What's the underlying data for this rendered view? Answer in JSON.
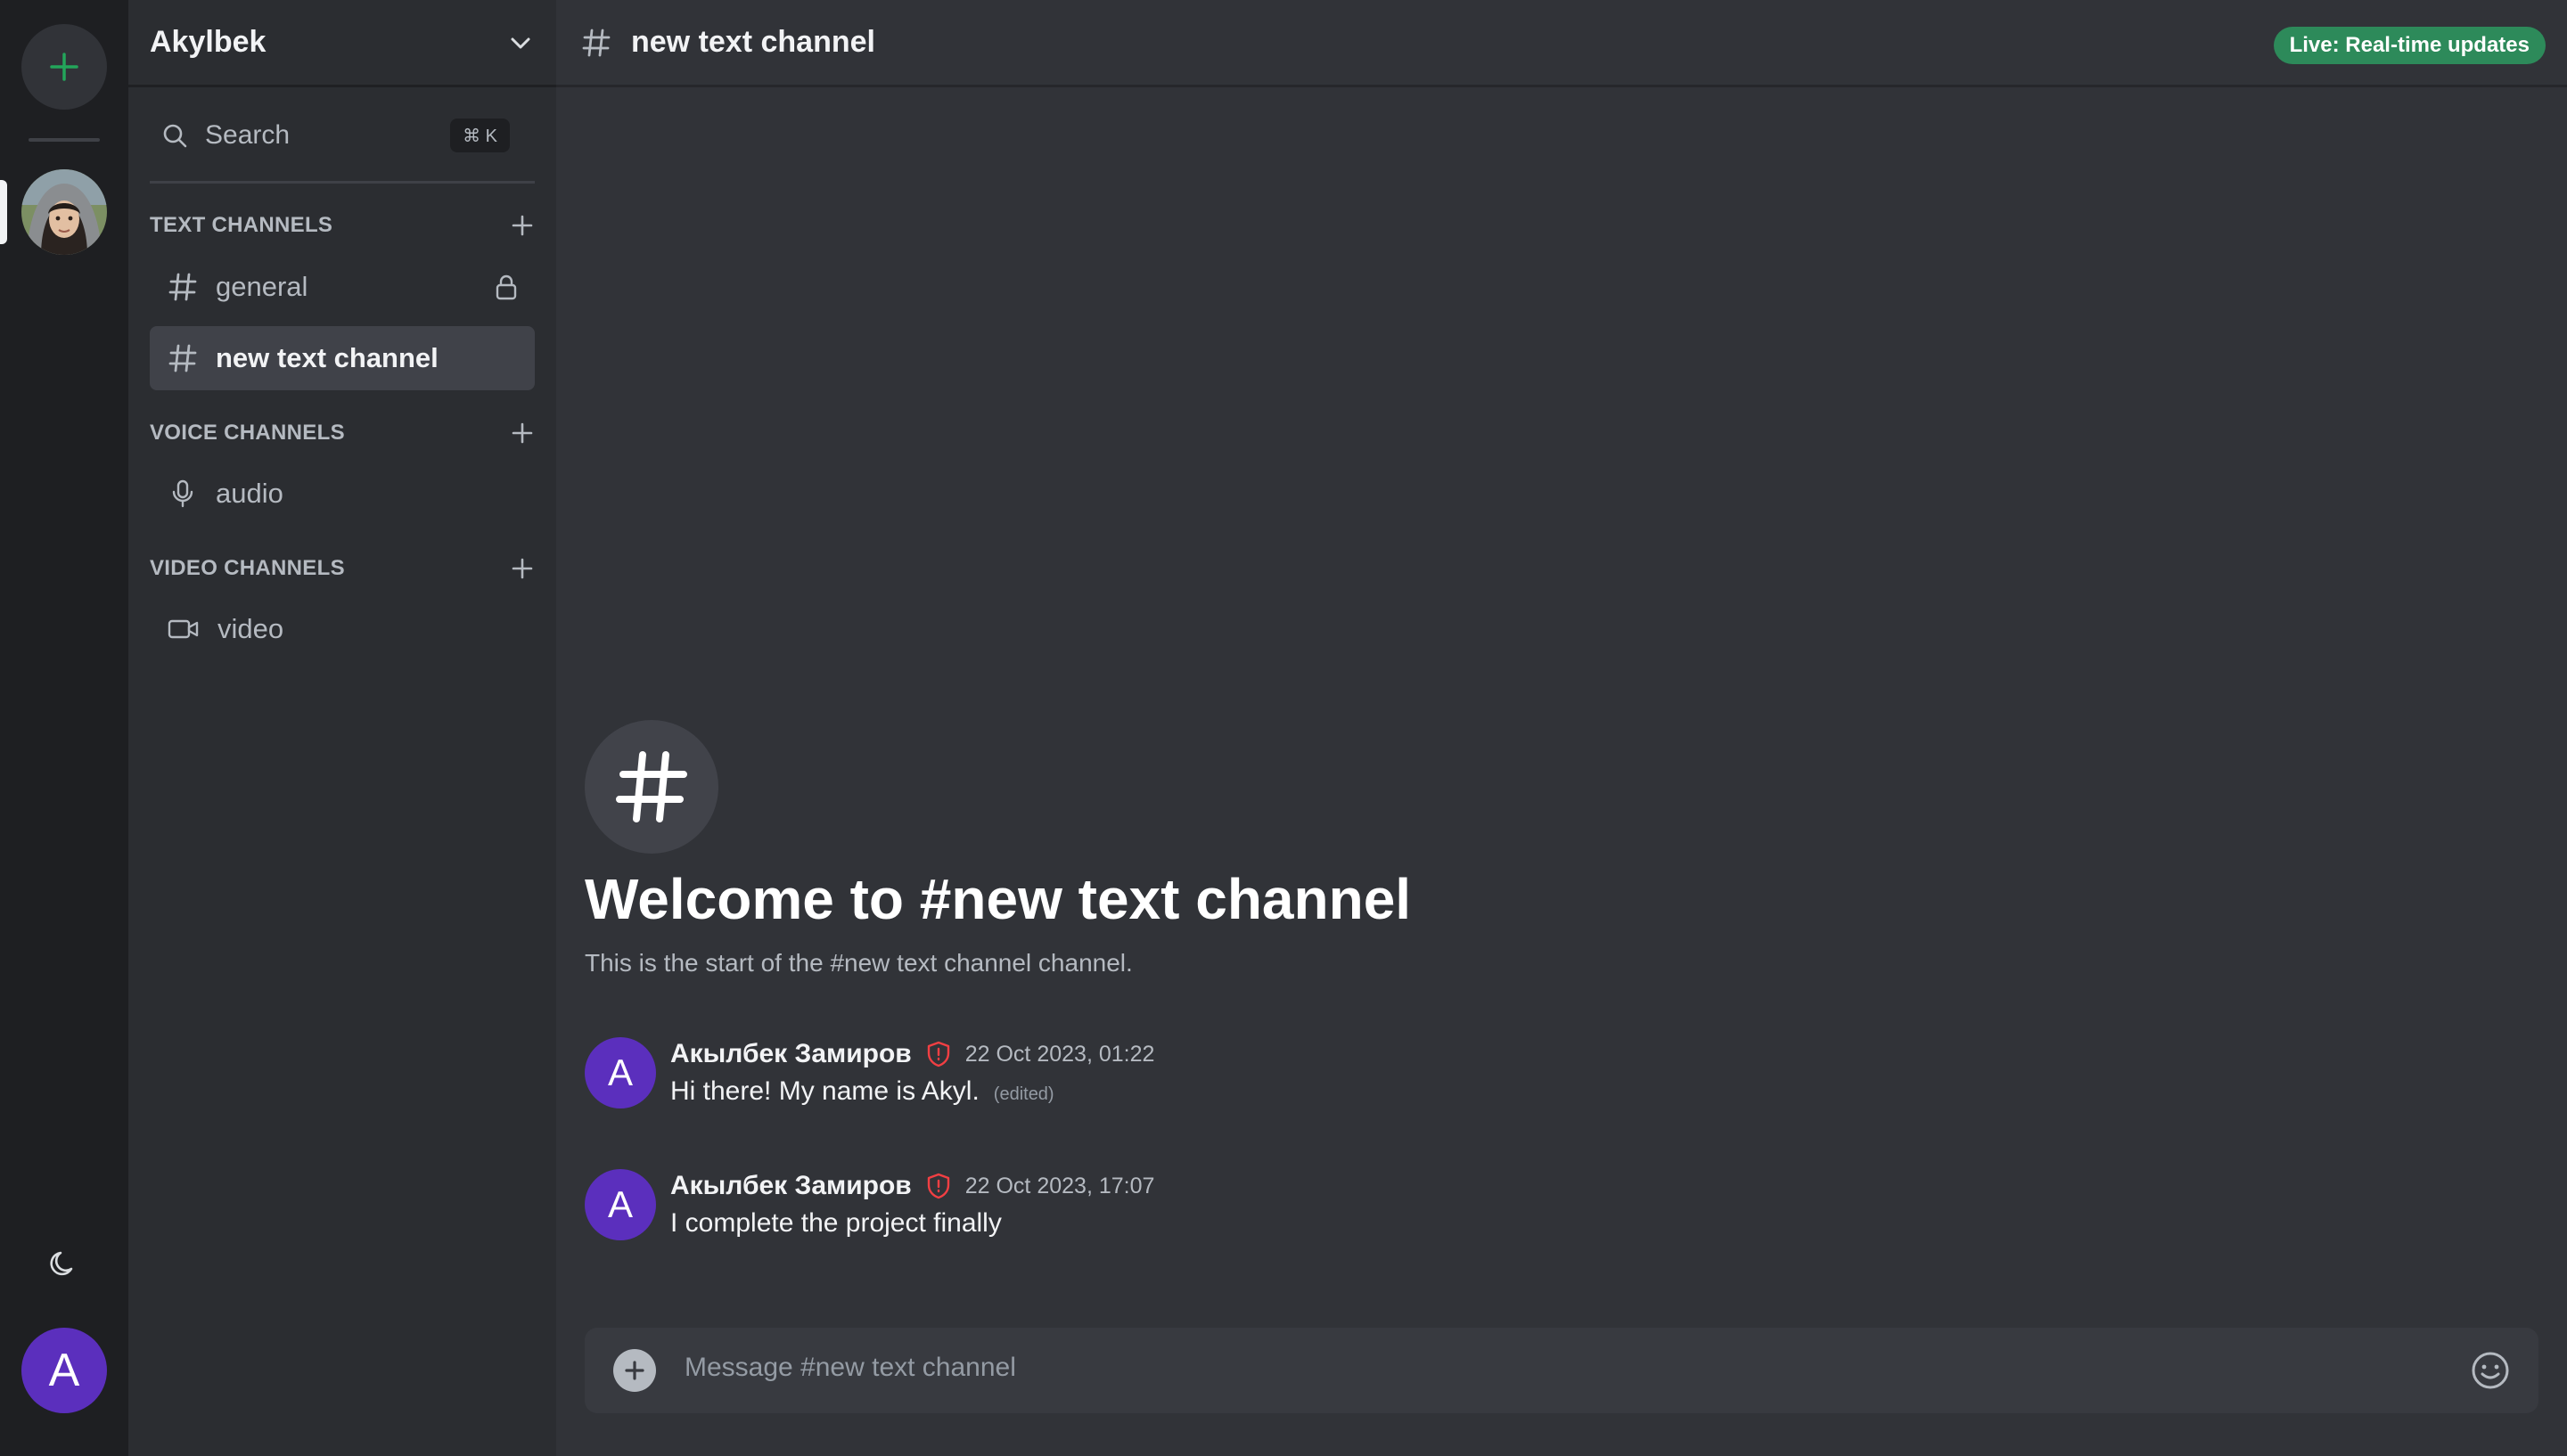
{
  "server": {
    "name": "Akylbek"
  },
  "search": {
    "label": "Search",
    "shortcut": "⌘ K"
  },
  "sections": {
    "text": {
      "title": "TEXT CHANNELS"
    },
    "voice": {
      "title": "VOICE CHANNELS"
    },
    "video": {
      "title": "VIDEO CHANNELS"
    }
  },
  "channels": {
    "text": [
      {
        "name": "general",
        "locked": true,
        "active": false
      },
      {
        "name": "new text channel",
        "locked": false,
        "active": true
      }
    ],
    "voice": [
      {
        "name": "audio"
      }
    ],
    "video": [
      {
        "name": "video"
      }
    ]
  },
  "header": {
    "channel_title": "new text channel",
    "live_badge": "Live: Real-time updates"
  },
  "welcome": {
    "title": "Welcome to #new text channel",
    "subtitle": "This is the start of the #new text channel channel."
  },
  "messages": [
    {
      "avatar_letter": "A",
      "author": "Акылбек Замиров",
      "time": "22 Oct 2023, 01:22",
      "text": "Hi there! My name is Akyl.",
      "edited": "(edited)"
    },
    {
      "avatar_letter": "A",
      "author": "Акылбек Замиров",
      "time": "22 Oct 2023, 17:07",
      "text": "I complete the project finally",
      "edited": ""
    }
  ],
  "composer": {
    "placeholder": "Message #new text channel"
  },
  "user": {
    "avatar_letter": "A"
  },
  "colors": {
    "accent_green": "#23a55a",
    "live_badge": "#2d8a5a",
    "avatar_purple": "#5b2fbd",
    "moderator_shield": "#f23f43"
  },
  "icons": [
    "plus-icon",
    "chevron-down-icon",
    "search-icon",
    "hash-icon",
    "lock-icon",
    "microphone-icon",
    "video-camera-icon",
    "moon-icon",
    "shield-icon",
    "emoji-icon"
  ]
}
